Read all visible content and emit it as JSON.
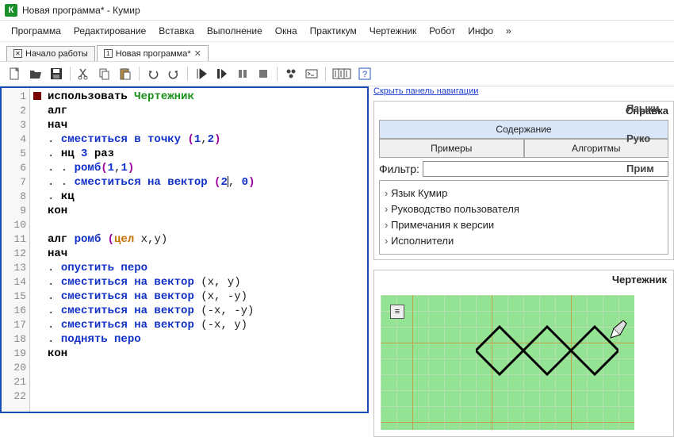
{
  "window": {
    "title": "Новая программа* - Кумир",
    "icon_letter": "К"
  },
  "menu": {
    "items": [
      "Программа",
      "Редактирование",
      "Вставка",
      "Выполнение",
      "Окна",
      "Практикум",
      "Чертежник",
      "Робот",
      "Инфо",
      "»"
    ]
  },
  "tabs": {
    "items": [
      {
        "label": "Начало работы",
        "closable": false,
        "active": false,
        "icon": "✕"
      },
      {
        "label": "Новая программа*",
        "closable": true,
        "active": true,
        "icon": "1"
      }
    ]
  },
  "code_lines": 22,
  "code": {
    "l1_use": "использовать",
    "l1_exec": "Чертежник",
    "l2": "алг",
    "l3": "нач",
    "l4_dot": ". ",
    "l4_cmd": "сместиться в точку",
    "l4_args": "(1,2)",
    "l5_dot": ". ",
    "l5_kw": "нц",
    "l5_num": "3",
    "l5_kw2": "раз",
    "l6_dot": ". . ",
    "l6_cmd": "ромб",
    "l6_args": "(1,1)",
    "l7_dot": ". . ",
    "l7_cmd": "сместиться на вектор",
    "l7_args_a": "(2",
    "l7_args_b": ", 0)",
    "l8_dot": ". ",
    "l8_kw": "кц",
    "l9": "кон",
    "l11a": "алг ",
    "l11b": "ромб ",
    "l11c": "(",
    "l11d": "цел",
    "l11e": " x,y)",
    "l12": "нач",
    "l13_dot": ". ",
    "l13_cmd": "опустить перо",
    "l14_dot": ". ",
    "l14_cmd": "сместиться на вектор",
    "l14_args": "(x, y)",
    "l15_dot": ". ",
    "l15_cmd": "сместиться на вектор",
    "l15_args": "(x, -y)",
    "l16_dot": ". ",
    "l16_cmd": "сместиться на вектор",
    "l16_args": "(-x, -y)",
    "l17_dot": ". ",
    "l17_cmd": "сместиться на вектор",
    "l17_args": "(-x, y)",
    "l18_dot": ". ",
    "l18_cmd": "поднять перо",
    "l19": "кон"
  },
  "help": {
    "panel_title": "Справка",
    "hide_link": "Скрыть панель навигации",
    "tabs": [
      "Содержание",
      "Примеры",
      "Алгоритмы"
    ],
    "filter_label": "Фильтр:",
    "tree": [
      "Язык Кумир",
      "Руководство пользователя",
      "Примечания к версии",
      "Исполнители"
    ],
    "side": [
      "Языки",
      "Руко",
      "Прим"
    ]
  },
  "drawer": {
    "title": "Чертежник",
    "menu_glyph": "≡"
  }
}
